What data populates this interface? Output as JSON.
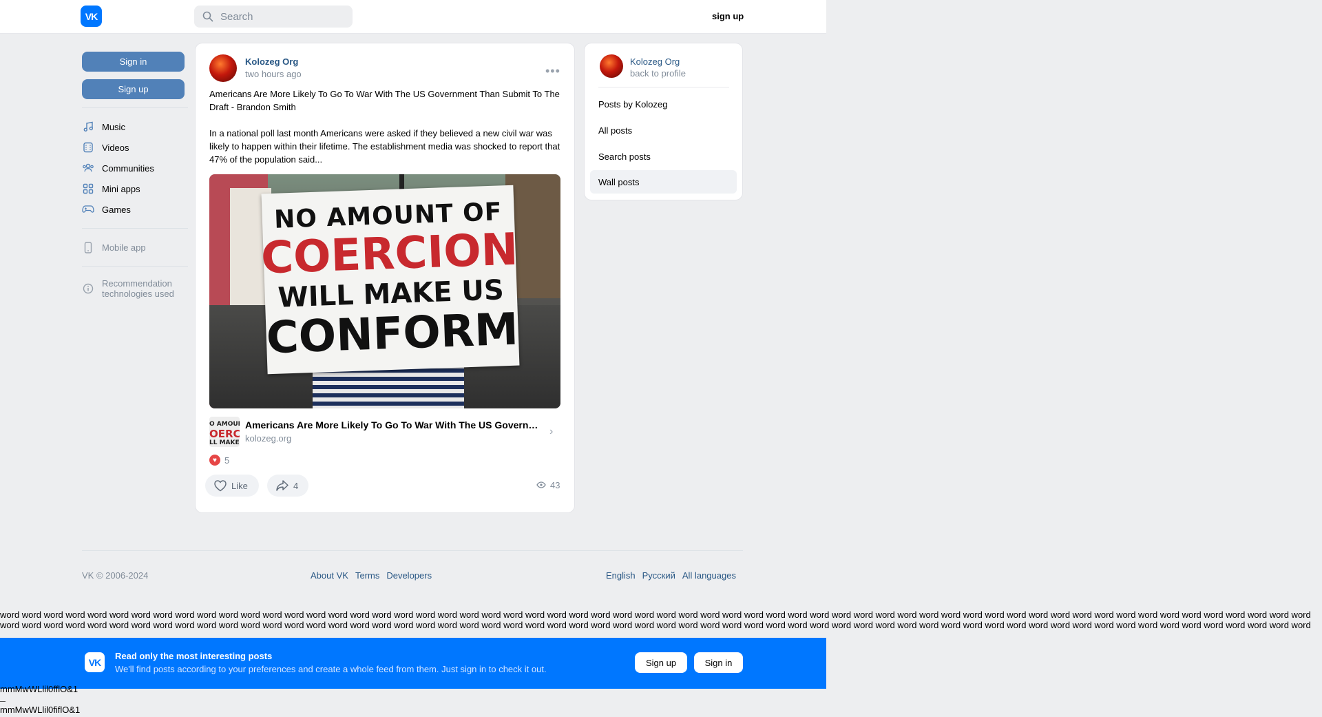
{
  "header": {
    "search_placeholder": "Search",
    "signup_label": "sign up"
  },
  "sidebar": {
    "signin_label": "Sign in",
    "signup_label": "Sign up",
    "items": [
      {
        "label": "Music",
        "icon": "music-icon"
      },
      {
        "label": "Videos",
        "icon": "video-icon"
      },
      {
        "label": "Communities",
        "icon": "communities-icon"
      },
      {
        "label": "Mini apps",
        "icon": "mini-apps-icon"
      },
      {
        "label": "Games",
        "icon": "games-icon"
      }
    ],
    "mobile_app": "Mobile app",
    "recommendation": "Recommendation technologies used"
  },
  "post": {
    "author": "Kolozeg Org",
    "time": "two hours ago",
    "title_text": "Americans Are More Likely To Go To War With The US Government Than Submit To The Draft - Brandon Smith",
    "body_text": "In a national poll last month Americans were asked if they believed a new civil war was likely to happen within their lifetime. The establishment media was shocked to report that 47% of the population said...",
    "image_sign": {
      "line1": "NO AMOUNT OF",
      "line2": "COERCION",
      "line3": "WILL MAKE US",
      "line4": "CONFORM"
    },
    "link": {
      "title": "Americans Are More Likely To Go To War With The US Governme...",
      "domain": "kolozeg.org",
      "thumb_line1": "O AMOUNT O",
      "thumb_line2": "OERCIO",
      "thumb_line3": "LL MAKE"
    },
    "likes_count": "5",
    "like_label": "Like",
    "shares_count": "4",
    "views_count": "43"
  },
  "profile_card": {
    "name": "Kolozeg Org",
    "back_label": "back to profile",
    "menu": [
      {
        "label": "Posts by Kolozeg",
        "active": false
      },
      {
        "label": "All posts",
        "active": false
      },
      {
        "label": "Search posts",
        "active": false
      },
      {
        "label": "Wall posts",
        "active": true
      }
    ]
  },
  "footer": {
    "copyright": "VK © 2006-2024",
    "links": [
      "About VK",
      "Terms",
      "Developers"
    ],
    "languages": [
      "English",
      "Русский",
      "All languages"
    ]
  },
  "filler_word": "word",
  "banner": {
    "title": "Read only the most interesting posts",
    "subtitle": "We'll find posts according to your preferences and create a whole feed from them. Just sign in to check it out.",
    "signup_label": "Sign up",
    "signin_label": "Sign in"
  },
  "font_test": {
    "line1": "mmMwWLlil0fflO&1",
    "line2": "mmMwWLlil0fiflO&1"
  },
  "colors": {
    "brand": "#0077ff",
    "link": "#2a5885",
    "button": "#5181b8",
    "background": "#edeef0"
  }
}
